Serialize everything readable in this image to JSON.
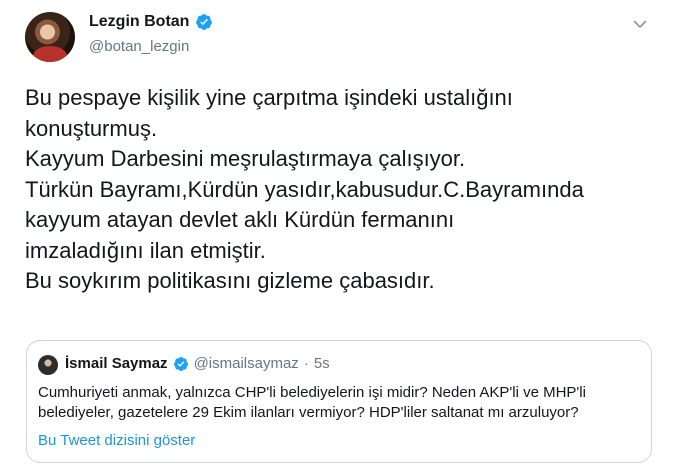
{
  "author": {
    "display_name": "Lezgin Botan",
    "handle": "@botan_lezgin",
    "verified": true
  },
  "tweet": {
    "lines": [
      "Bu pespaye kişilik yine çarpıtma işindeki ustalığını",
      "konuşturmuş.",
      "Kayyum Darbesini meşrulaştırmaya çalışıyor.",
      "Türkün Bayramı,Kürdün yasıdır,kabusudur.C.Bayramında",
      "kayyum atayan devlet aklı Kürdün fermanını",
      "imzaladığını ilan etmiştir.",
      "Bu soykırım politikasını gizleme çabasıdır."
    ]
  },
  "quote": {
    "display_name": "İsmail Saymaz",
    "handle": "@ismailsaymaz",
    "separator": "·",
    "time": "5s",
    "verified": true,
    "text_lines": [
      "Cumhuriyeti anmak, yalnızca CHP'li belediyelerin işi midir? Neden AKP'li ve MHP'li",
      "belediyeler, gazetelere 29 Ekim ilanları vermiyor? HDP'liler saltanat mı arzuluyor?"
    ],
    "thread_link": "Bu Tweet dizisini göster"
  },
  "icons": {
    "verified": "verified-badge-icon",
    "more": "chevron-down-icon"
  },
  "colors": {
    "link": "#1b95e0",
    "verified": "#1da1f2",
    "secondary_text": "#657786",
    "border": "#ccd6dd"
  }
}
